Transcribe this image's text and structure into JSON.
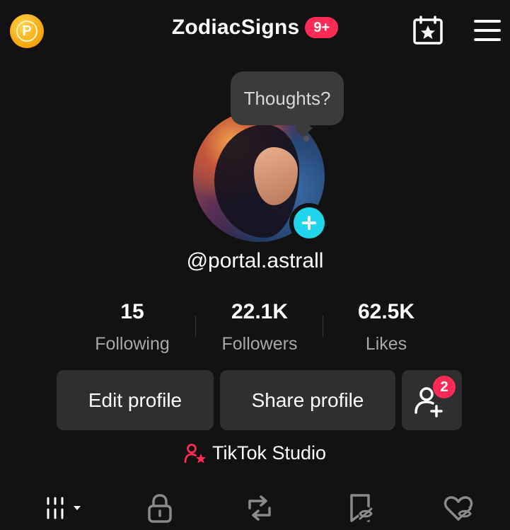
{
  "header": {
    "coin_letter": "P",
    "title": "ZodiacSigns",
    "notification_count": "9+"
  },
  "profile": {
    "thought_bubble": "Thoughts?",
    "username": "@portal.astrall"
  },
  "stats": [
    {
      "value": "15",
      "label": "Following"
    },
    {
      "value": "22.1K",
      "label": "Followers"
    },
    {
      "value": "62.5K",
      "label": "Likes"
    }
  ],
  "actions": {
    "edit_profile": "Edit profile",
    "share_profile": "Share profile",
    "friend_requests_count": "2"
  },
  "studio": {
    "label": "TikTok Studio"
  },
  "tabs": [
    {
      "icon": "grid-icon"
    },
    {
      "icon": "lock-icon"
    },
    {
      "icon": "repost-icon"
    },
    {
      "icon": "bookmark-hidden-icon"
    },
    {
      "icon": "liked-hidden-icon"
    }
  ],
  "colors": {
    "accent_red": "#fe2c55",
    "accent_cyan": "#20d5ec",
    "coin_gold": "#f4a40c",
    "background": "#121212"
  }
}
